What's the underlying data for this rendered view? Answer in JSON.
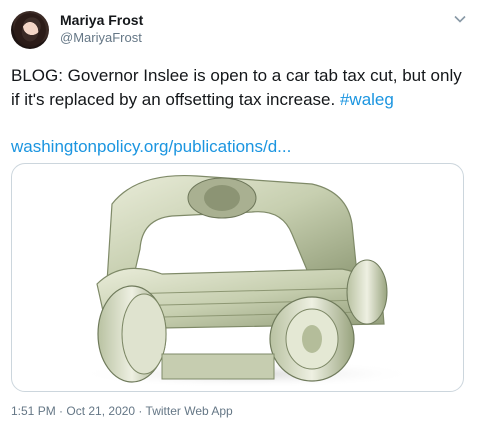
{
  "author": {
    "name": "Mariya Frost",
    "handle": "@MariyaFrost"
  },
  "tweet": {
    "text": "BLOG: Governor Inslee is open to a car tab tax cut, but only if it's replaced by an offsetting tax increase.",
    "hashtag": "#waleg",
    "link": "washingtonpolicy.org/publications/d...",
    "media_icon": "money-car-image"
  },
  "meta": {
    "time": "1:51 PM",
    "sep1": " · ",
    "date": "Oct 21, 2020",
    "sep2": " · ",
    "source": "Twitter Web App"
  },
  "colors": {
    "link": "#1b95e0",
    "secondary": "#657786",
    "border": "#ccd6dd"
  }
}
